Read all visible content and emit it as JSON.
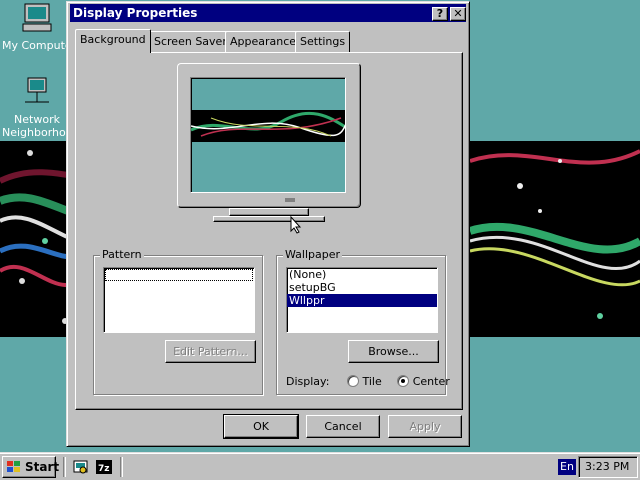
{
  "desktop": {
    "icons": [
      {
        "label": "My Computer",
        "icon": "my-computer-icon"
      },
      {
        "label": "Network Neighborhood",
        "icon": "network-neighborhood-icon"
      }
    ]
  },
  "dialog": {
    "title": "Display Properties",
    "help_glyph": "?",
    "close_glyph": "✕",
    "tabs": [
      {
        "label": "Background",
        "active": true
      },
      {
        "label": "Screen Saver",
        "active": false
      },
      {
        "label": "Appearance",
        "active": false
      },
      {
        "label": "Settings",
        "active": false
      }
    ],
    "pattern": {
      "label": "Pattern",
      "edit_button": "Edit Pattern..."
    },
    "wallpaper": {
      "label": "Wallpaper",
      "items": [
        "(None)",
        "setupBG",
        "Wllppr"
      ],
      "selected": "Wllppr",
      "browse_button": "Browse...",
      "display_label": "Display:",
      "display_options": [
        {
          "label": "Tile",
          "selected": false
        },
        {
          "label": "Center",
          "selected": true
        }
      ]
    },
    "buttons": {
      "ok": "OK",
      "cancel": "Cancel",
      "apply": "Apply"
    }
  },
  "taskbar": {
    "start_label": "Start",
    "language": "En",
    "clock": "3:23 PM"
  },
  "colors": {
    "desktop": "#5fa8a8",
    "title_bar": "#000080",
    "selection": "#000080"
  }
}
